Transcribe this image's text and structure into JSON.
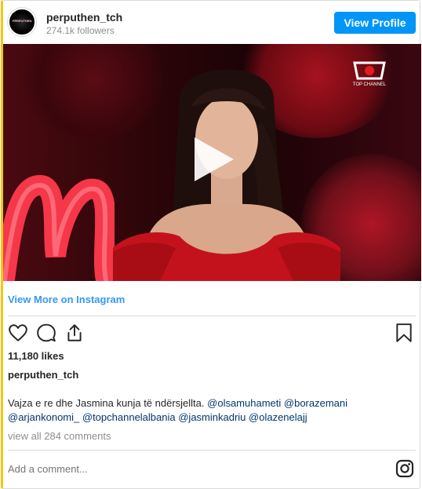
{
  "header": {
    "avatar_text": "PËRPUTHEN",
    "username": "perputhen_tch",
    "followers": "274.1k followers",
    "view_profile_label": "View Profile"
  },
  "media": {
    "logo_text": "TOP CHANNEL",
    "play_icon": "play-icon"
  },
  "links": {
    "view_more": "View More on Instagram"
  },
  "actions": {
    "like_icon": "heart-icon",
    "comment_icon": "comment-icon",
    "share_icon": "share-icon",
    "save_icon": "bookmark-icon"
  },
  "post": {
    "likes": "11,180 likes",
    "caption_user": "perputhen_tch",
    "caption_text": "Vajza e re dhe Jasmina kunja të ndërsjellta.",
    "mentions": [
      "@olsamuhameti",
      "@borazemani",
      "@arjankonomi_",
      "@topchannelalbania",
      "@jasminkadriu",
      "@olazenelajj"
    ],
    "view_comments": "view all 284 comments"
  },
  "comment": {
    "placeholder": "Add a comment..."
  },
  "colors": {
    "accent": "#0095f6",
    "link": "#3897f0",
    "muted": "#8e8e8e",
    "left_border": "#f5c518"
  }
}
